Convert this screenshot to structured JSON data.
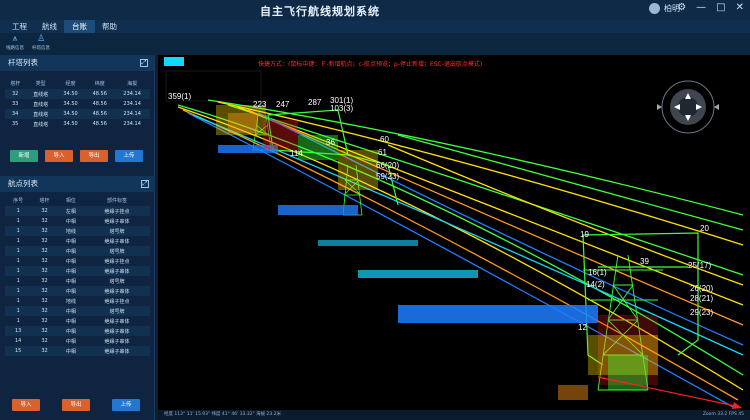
{
  "app": {
    "title": "自主飞行航线规划系统",
    "user": "柏明"
  },
  "menu": [
    "工程",
    "航线",
    "台账",
    "帮助"
  ],
  "menu_active": 2,
  "toolbar": [
    {
      "icon": "tower-icon",
      "label": "线路信息"
    },
    {
      "icon": "tower-info-icon",
      "label": "杆塔信息"
    }
  ],
  "tower_panel": {
    "title": "杆塔列表",
    "headers": [
      "塔杆",
      "类型",
      "经度",
      "纬度",
      "海拔"
    ],
    "rows": [
      [
        "32",
        "直线塔",
        "34.50",
        "48.56",
        "234.14"
      ],
      [
        "33",
        "直线塔",
        "34.50",
        "48.56",
        "234.14"
      ],
      [
        "34",
        "直线塔",
        "34.50",
        "48.56",
        "234.14"
      ],
      [
        "35",
        "直线塔",
        "34.50",
        "48.56",
        "234.14"
      ]
    ],
    "buttons": [
      "新增",
      "导入",
      "导出",
      "上传"
    ]
  },
  "waypoint_panel": {
    "title": "航点列表",
    "headers": [
      "序号",
      "塔杆",
      "相位",
      "部件标签"
    ],
    "rows": [
      [
        "1",
        "32",
        "左相",
        "绝缘子挂点"
      ],
      [
        "1",
        "32",
        "中相",
        "绝缘子串体"
      ],
      [
        "1",
        "32",
        "地线",
        "塔号牌"
      ],
      [
        "1",
        "32",
        "中相",
        "绝缘子串体"
      ],
      [
        "1",
        "32",
        "中相",
        "塔号牌"
      ],
      [
        "1",
        "32",
        "中相",
        "绝缘子挂点"
      ],
      [
        "1",
        "32",
        "中相",
        "绝缘子串体"
      ],
      [
        "1",
        "32",
        "中相",
        "塔号牌"
      ],
      [
        "1",
        "32",
        "中相",
        "绝缘子串体"
      ],
      [
        "1",
        "32",
        "地线",
        "绝缘子挂点"
      ],
      [
        "1",
        "32",
        "中相",
        "塔号牌"
      ],
      [
        "1",
        "32",
        "中相",
        "绝缘子串体"
      ],
      [
        "13",
        "32",
        "中相",
        "绝缘子串体"
      ],
      [
        "14",
        "32",
        "中相",
        "绝缘子串体"
      ],
      [
        "15",
        "32",
        "中相",
        "绝缘子串体"
      ]
    ],
    "buttons": [
      "导入",
      "导出",
      "上传"
    ]
  },
  "viewport": {
    "hint": "快捷方式：(鼠标中键：Ｆ-新增航点；c-航点预览；p-停止新增；ESC-退出航点模式)",
    "labels": [
      "359(1)",
      "223",
      "247",
      "287",
      "301(1)",
      "103(3)",
      "60",
      "61",
      "66(20)",
      "59(23)",
      "114",
      "36",
      "19",
      "20",
      "39",
      "25(17)",
      "16(1)",
      "26(20)",
      "28(21)",
      "29(23)",
      "12",
      "14(2)"
    ],
    "colors": {
      "cyan": "#12d7ff",
      "green": "#3cff3c",
      "yellow": "#ffe000",
      "red": "#ff2020",
      "blue": "#1e7dff",
      "orange": "#ff9a1a"
    }
  },
  "statusbar": {
    "left": "经度 113° 11' 15.93\"  纬度 41° 46' 33.32\"  海拔 23.2米",
    "right": "Zoom 33.2  FPS 45"
  }
}
